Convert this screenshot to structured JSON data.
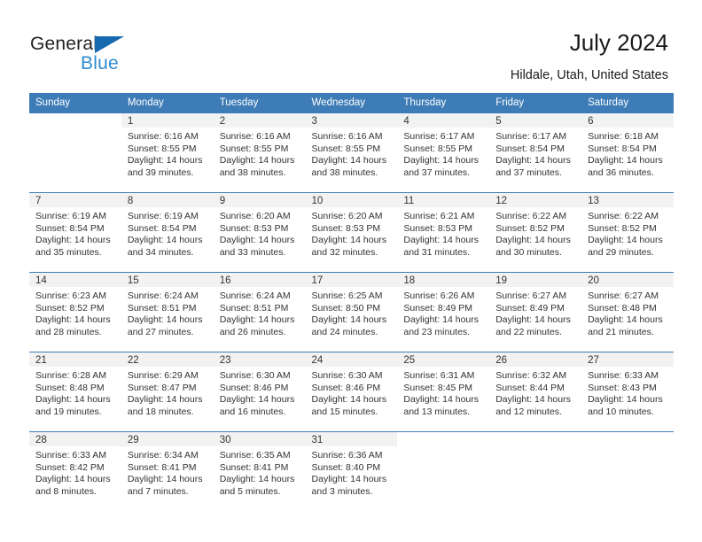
{
  "brand": {
    "name_primary": "General",
    "name_secondary": "Blue",
    "triangle_color": "#1769b0",
    "secondary_color": "#2e8bd0"
  },
  "header": {
    "title": "July 2024",
    "subtitle": "Hildale, Utah, United States",
    "header_bg": "#3d7cb6",
    "daynum_bg": "#f2f2f2"
  },
  "weekday_headers": [
    "Sunday",
    "Monday",
    "Tuesday",
    "Wednesday",
    "Thursday",
    "Friday",
    "Saturday"
  ],
  "labels": {
    "sunrise_prefix": "Sunrise:",
    "sunset_prefix": "Sunset:",
    "daylight_prefix": "Daylight:"
  },
  "weeks": [
    [
      {
        "day": "",
        "sunrise": "",
        "sunset": "",
        "daylight_line1": "",
        "daylight_line2": "",
        "empty": true
      },
      {
        "day": "1",
        "sunrise": "Sunrise: 6:16 AM",
        "sunset": "Sunset: 8:55 PM",
        "daylight_line1": "Daylight: 14 hours",
        "daylight_line2": "and 39 minutes.",
        "empty": false
      },
      {
        "day": "2",
        "sunrise": "Sunrise: 6:16 AM",
        "sunset": "Sunset: 8:55 PM",
        "daylight_line1": "Daylight: 14 hours",
        "daylight_line2": "and 38 minutes.",
        "empty": false
      },
      {
        "day": "3",
        "sunrise": "Sunrise: 6:16 AM",
        "sunset": "Sunset: 8:55 PM",
        "daylight_line1": "Daylight: 14 hours",
        "daylight_line2": "and 38 minutes.",
        "empty": false
      },
      {
        "day": "4",
        "sunrise": "Sunrise: 6:17 AM",
        "sunset": "Sunset: 8:55 PM",
        "daylight_line1": "Daylight: 14 hours",
        "daylight_line2": "and 37 minutes.",
        "empty": false
      },
      {
        "day": "5",
        "sunrise": "Sunrise: 6:17 AM",
        "sunset": "Sunset: 8:54 PM",
        "daylight_line1": "Daylight: 14 hours",
        "daylight_line2": "and 37 minutes.",
        "empty": false
      },
      {
        "day": "6",
        "sunrise": "Sunrise: 6:18 AM",
        "sunset": "Sunset: 8:54 PM",
        "daylight_line1": "Daylight: 14 hours",
        "daylight_line2": "and 36 minutes.",
        "empty": false
      }
    ],
    [
      {
        "day": "7",
        "sunrise": "Sunrise: 6:19 AM",
        "sunset": "Sunset: 8:54 PM",
        "daylight_line1": "Daylight: 14 hours",
        "daylight_line2": "and 35 minutes.",
        "empty": false
      },
      {
        "day": "8",
        "sunrise": "Sunrise: 6:19 AM",
        "sunset": "Sunset: 8:54 PM",
        "daylight_line1": "Daylight: 14 hours",
        "daylight_line2": "and 34 minutes.",
        "empty": false
      },
      {
        "day": "9",
        "sunrise": "Sunrise: 6:20 AM",
        "sunset": "Sunset: 8:53 PM",
        "daylight_line1": "Daylight: 14 hours",
        "daylight_line2": "and 33 minutes.",
        "empty": false
      },
      {
        "day": "10",
        "sunrise": "Sunrise: 6:20 AM",
        "sunset": "Sunset: 8:53 PM",
        "daylight_line1": "Daylight: 14 hours",
        "daylight_line2": "and 32 minutes.",
        "empty": false
      },
      {
        "day": "11",
        "sunrise": "Sunrise: 6:21 AM",
        "sunset": "Sunset: 8:53 PM",
        "daylight_line1": "Daylight: 14 hours",
        "daylight_line2": "and 31 minutes.",
        "empty": false
      },
      {
        "day": "12",
        "sunrise": "Sunrise: 6:22 AM",
        "sunset": "Sunset: 8:52 PM",
        "daylight_line1": "Daylight: 14 hours",
        "daylight_line2": "and 30 minutes.",
        "empty": false
      },
      {
        "day": "13",
        "sunrise": "Sunrise: 6:22 AM",
        "sunset": "Sunset: 8:52 PM",
        "daylight_line1": "Daylight: 14 hours",
        "daylight_line2": "and 29 minutes.",
        "empty": false
      }
    ],
    [
      {
        "day": "14",
        "sunrise": "Sunrise: 6:23 AM",
        "sunset": "Sunset: 8:52 PM",
        "daylight_line1": "Daylight: 14 hours",
        "daylight_line2": "and 28 minutes.",
        "empty": false
      },
      {
        "day": "15",
        "sunrise": "Sunrise: 6:24 AM",
        "sunset": "Sunset: 8:51 PM",
        "daylight_line1": "Daylight: 14 hours",
        "daylight_line2": "and 27 minutes.",
        "empty": false
      },
      {
        "day": "16",
        "sunrise": "Sunrise: 6:24 AM",
        "sunset": "Sunset: 8:51 PM",
        "daylight_line1": "Daylight: 14 hours",
        "daylight_line2": "and 26 minutes.",
        "empty": false
      },
      {
        "day": "17",
        "sunrise": "Sunrise: 6:25 AM",
        "sunset": "Sunset: 8:50 PM",
        "daylight_line1": "Daylight: 14 hours",
        "daylight_line2": "and 24 minutes.",
        "empty": false
      },
      {
        "day": "18",
        "sunrise": "Sunrise: 6:26 AM",
        "sunset": "Sunset: 8:49 PM",
        "daylight_line1": "Daylight: 14 hours",
        "daylight_line2": "and 23 minutes.",
        "empty": false
      },
      {
        "day": "19",
        "sunrise": "Sunrise: 6:27 AM",
        "sunset": "Sunset: 8:49 PM",
        "daylight_line1": "Daylight: 14 hours",
        "daylight_line2": "and 22 minutes.",
        "empty": false
      },
      {
        "day": "20",
        "sunrise": "Sunrise: 6:27 AM",
        "sunset": "Sunset: 8:48 PM",
        "daylight_line1": "Daylight: 14 hours",
        "daylight_line2": "and 21 minutes.",
        "empty": false
      }
    ],
    [
      {
        "day": "21",
        "sunrise": "Sunrise: 6:28 AM",
        "sunset": "Sunset: 8:48 PM",
        "daylight_line1": "Daylight: 14 hours",
        "daylight_line2": "and 19 minutes.",
        "empty": false
      },
      {
        "day": "22",
        "sunrise": "Sunrise: 6:29 AM",
        "sunset": "Sunset: 8:47 PM",
        "daylight_line1": "Daylight: 14 hours",
        "daylight_line2": "and 18 minutes.",
        "empty": false
      },
      {
        "day": "23",
        "sunrise": "Sunrise: 6:30 AM",
        "sunset": "Sunset: 8:46 PM",
        "daylight_line1": "Daylight: 14 hours",
        "daylight_line2": "and 16 minutes.",
        "empty": false
      },
      {
        "day": "24",
        "sunrise": "Sunrise: 6:30 AM",
        "sunset": "Sunset: 8:46 PM",
        "daylight_line1": "Daylight: 14 hours",
        "daylight_line2": "and 15 minutes.",
        "empty": false
      },
      {
        "day": "25",
        "sunrise": "Sunrise: 6:31 AM",
        "sunset": "Sunset: 8:45 PM",
        "daylight_line1": "Daylight: 14 hours",
        "daylight_line2": "and 13 minutes.",
        "empty": false
      },
      {
        "day": "26",
        "sunrise": "Sunrise: 6:32 AM",
        "sunset": "Sunset: 8:44 PM",
        "daylight_line1": "Daylight: 14 hours",
        "daylight_line2": "and 12 minutes.",
        "empty": false
      },
      {
        "day": "27",
        "sunrise": "Sunrise: 6:33 AM",
        "sunset": "Sunset: 8:43 PM",
        "daylight_line1": "Daylight: 14 hours",
        "daylight_line2": "and 10 minutes.",
        "empty": false
      }
    ],
    [
      {
        "day": "28",
        "sunrise": "Sunrise: 6:33 AM",
        "sunset": "Sunset: 8:42 PM",
        "daylight_line1": "Daylight: 14 hours",
        "daylight_line2": "and 8 minutes.",
        "empty": false
      },
      {
        "day": "29",
        "sunrise": "Sunrise: 6:34 AM",
        "sunset": "Sunset: 8:41 PM",
        "daylight_line1": "Daylight: 14 hours",
        "daylight_line2": "and 7 minutes.",
        "empty": false
      },
      {
        "day": "30",
        "sunrise": "Sunrise: 6:35 AM",
        "sunset": "Sunset: 8:41 PM",
        "daylight_line1": "Daylight: 14 hours",
        "daylight_line2": "and 5 minutes.",
        "empty": false
      },
      {
        "day": "31",
        "sunrise": "Sunrise: 6:36 AM",
        "sunset": "Sunset: 8:40 PM",
        "daylight_line1": "Daylight: 14 hours",
        "daylight_line2": "and 3 minutes.",
        "empty": false
      },
      {
        "day": "",
        "sunrise": "",
        "sunset": "",
        "daylight_line1": "",
        "daylight_line2": "",
        "empty": true
      },
      {
        "day": "",
        "sunrise": "",
        "sunset": "",
        "daylight_line1": "",
        "daylight_line2": "",
        "empty": true
      },
      {
        "day": "",
        "sunrise": "",
        "sunset": "",
        "daylight_line1": "",
        "daylight_line2": "",
        "empty": true
      }
    ]
  ]
}
